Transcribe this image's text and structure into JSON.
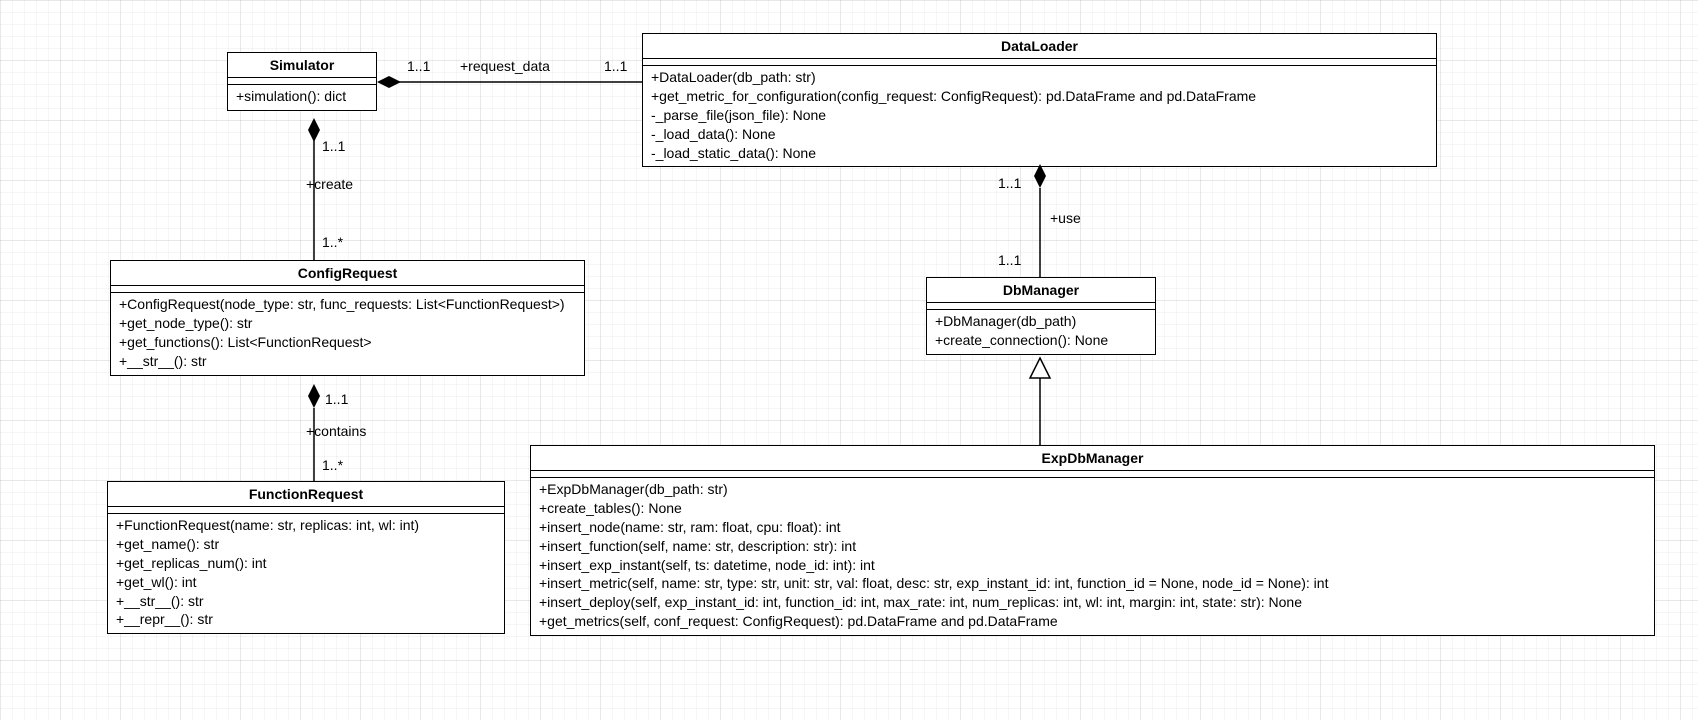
{
  "classes": {
    "simulator": {
      "name": "Simulator",
      "members": [
        "+simulation(): dict"
      ]
    },
    "dataloader": {
      "name": "DataLoader",
      "members": [
        "+DataLoader(db_path: str)",
        "+get_metric_for_configuration(config_request: ConfigRequest): pd.DataFrame and pd.DataFrame",
        "-_parse_file(json_file): None",
        "-_load_data(): None",
        "-_load_static_data(): None"
      ]
    },
    "configrequest": {
      "name": "ConfigRequest",
      "members": [
        "+ConfigRequest(node_type: str, func_requests: List<FunctionRequest>)",
        "+get_node_type(): str",
        "+get_functions(): List<FunctionRequest>",
        "+__str__(): str"
      ]
    },
    "dbmanager": {
      "name": "DbManager",
      "members": [
        "+DbManager(db_path)",
        "+create_connection(): None"
      ]
    },
    "functionrequest": {
      "name": "FunctionRequest",
      "members": [
        "+FunctionRequest(name: str, replicas: int, wl: int)",
        "+get_name(): str",
        "+get_replicas_num(): int",
        "+get_wl(): int",
        "+__str__(): str",
        "+__repr__(): str"
      ]
    },
    "expdbmanager": {
      "name": "ExpDbManager",
      "members": [
        "+ExpDbManager(db_path: str)",
        "+create_tables(): None",
        "+insert_node(name: str, ram: float, cpu: float): int",
        "+insert_function(self, name: str, description: str): int",
        "+insert_exp_instant(self, ts: datetime, node_id: int): int",
        "+insert_metric(self, name: str, type: str, unit: str, val: float, desc: str, exp_instant_id: int, function_id = None, node_id = None): int",
        "+insert_deploy(self, exp_instant_id: int, function_id: int, max_rate: int, num_replicas: int, wl: int, margin: int, state: str): None",
        "+get_metrics(self, conf_request: ConfigRequest): pd.DataFrame and pd.DataFrame"
      ]
    }
  },
  "labels": {
    "sim_dl_left_mult": "1..1",
    "sim_dl_right_mult": "1..1",
    "sim_dl_name": "+request_data",
    "sim_cr_top_mult": "1..1",
    "sim_cr_bot_mult": "1..*",
    "sim_cr_name": "+create",
    "cr_fr_top_mult": "1..1",
    "cr_fr_bot_mult": "1..*",
    "cr_fr_name": "+contains",
    "dl_db_top_mult": "1..1",
    "dl_db_bot_mult": "1..1",
    "dl_db_name": "+use"
  }
}
